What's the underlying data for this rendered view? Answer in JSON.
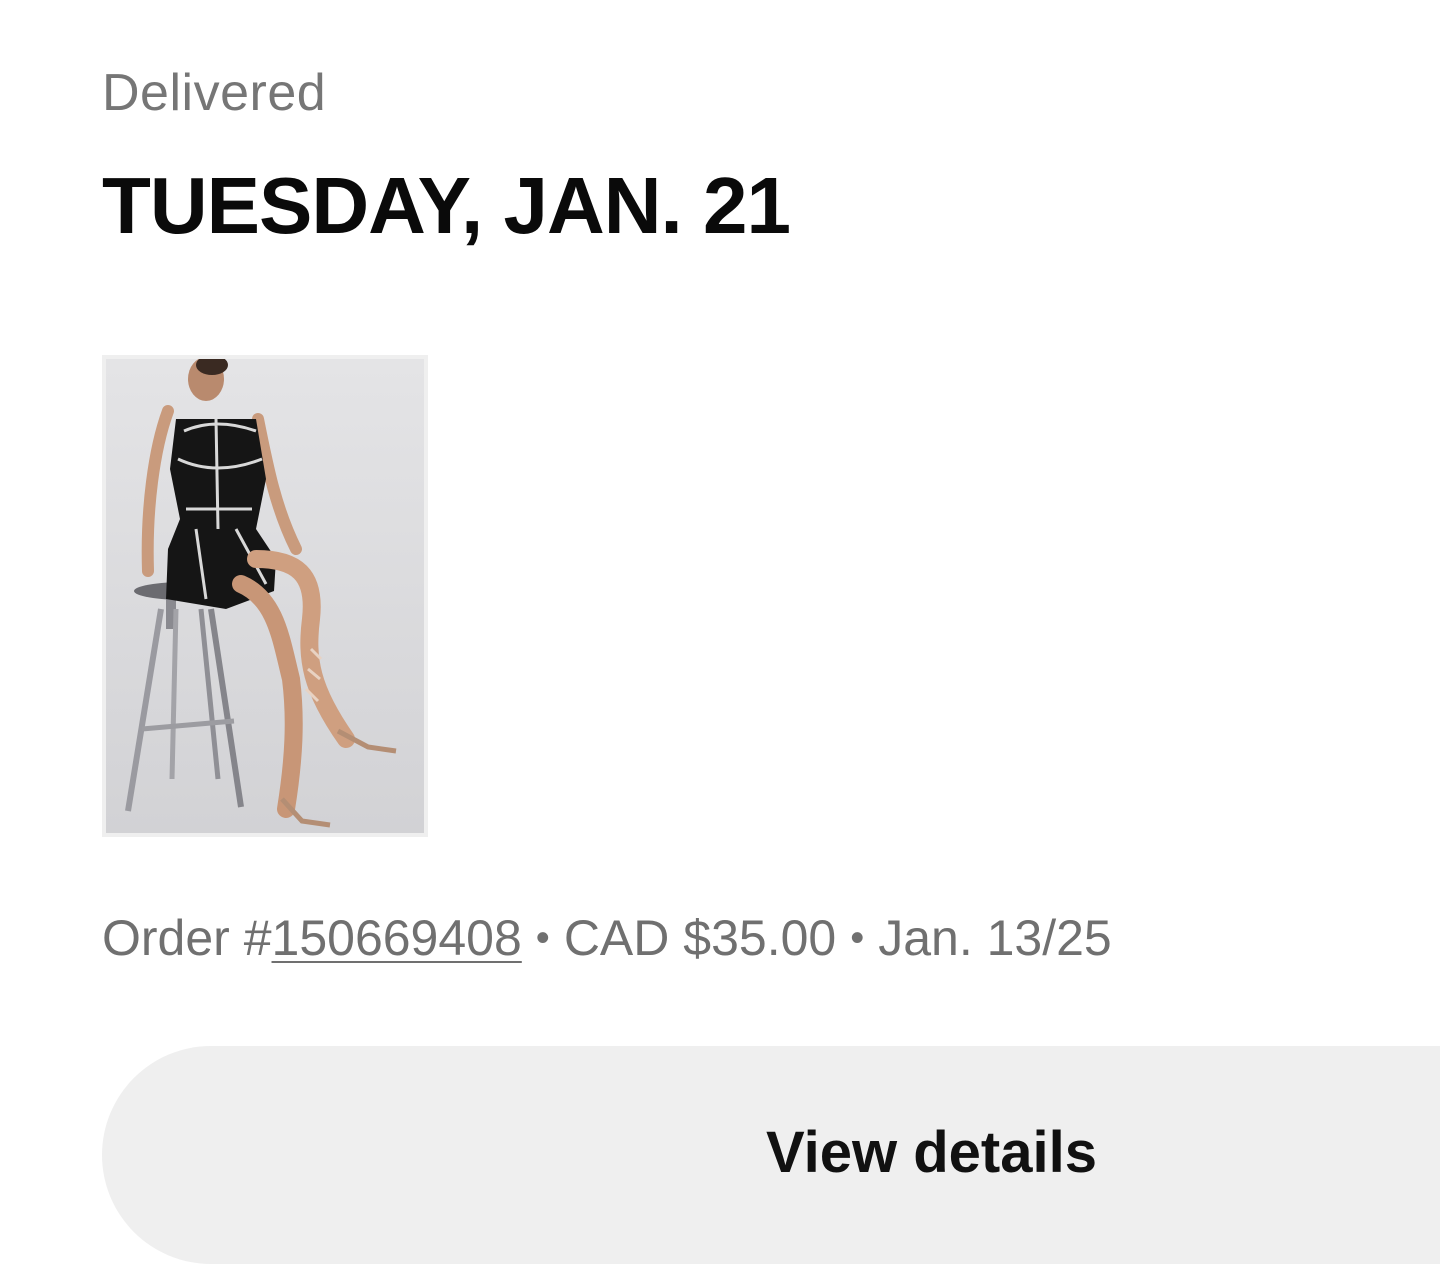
{
  "delivery": {
    "status": "Delivered",
    "date": "TUESDAY, JAN. 21"
  },
  "order": {
    "prefix": "Order #",
    "number": "150669408",
    "separator": "•",
    "price": "CAD $35.00",
    "placed_date": "Jan. 13/25"
  },
  "product_image": {
    "description": "product-photo"
  },
  "actions": {
    "view_details_label": "View details"
  },
  "colors": {
    "status_text": "#767676",
    "heading_text": "#0a0a0a",
    "meta_text": "#707070",
    "button_bg": "#efefef"
  }
}
